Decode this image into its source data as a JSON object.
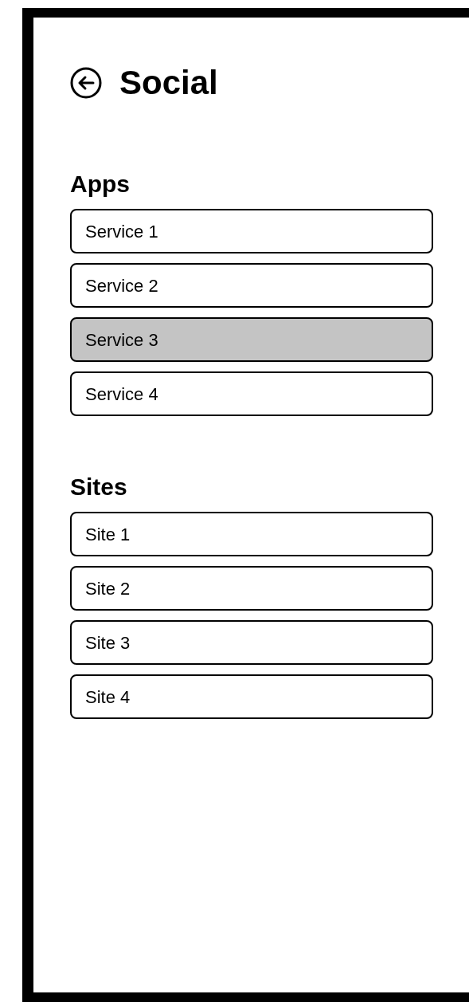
{
  "header": {
    "title": "Social"
  },
  "sections": [
    {
      "title": "Apps",
      "items": [
        {
          "label": "Service 1",
          "selected": false
        },
        {
          "label": "Service 2",
          "selected": false
        },
        {
          "label": "Service 3",
          "selected": true
        },
        {
          "label": "Service 4",
          "selected": false
        }
      ]
    },
    {
      "title": "Sites",
      "items": [
        {
          "label": "Site 1",
          "selected": false
        },
        {
          "label": "Site 2",
          "selected": false
        },
        {
          "label": "Site 3",
          "selected": false
        },
        {
          "label": "Site 4",
          "selected": false
        }
      ]
    }
  ]
}
